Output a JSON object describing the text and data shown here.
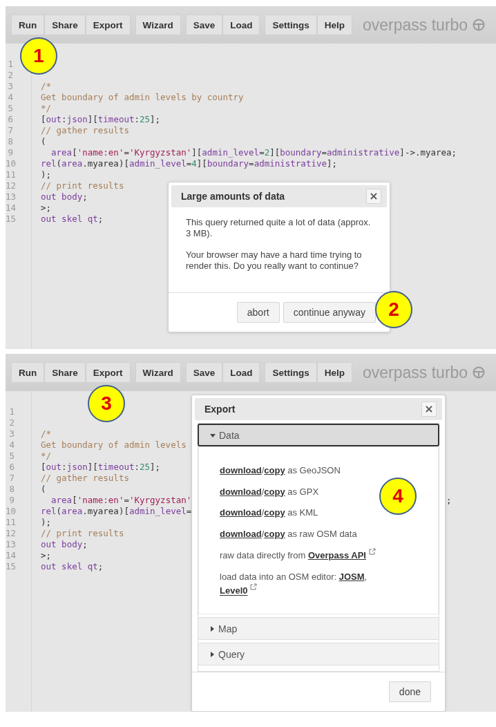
{
  "panels": [
    {
      "toolbar": {
        "groups": [
          [
            "Run",
            "Share",
            "Export"
          ],
          [
            "Wizard"
          ],
          [
            "Save",
            "Load"
          ],
          [
            "Settings",
            "Help"
          ]
        ],
        "brand": "overpass turbo"
      },
      "code": [
        {
          "number": "1"
        },
        {
          "number": "2"
        },
        {
          "number": "3",
          "tokens": [
            {
              "kind": "comment",
              "t": "/*"
            }
          ]
        },
        {
          "number": "4",
          "tokens": [
            {
              "kind": "comment",
              "t": "Get boundary of admin levels by country"
            }
          ]
        },
        {
          "number": "5",
          "tokens": [
            {
              "kind": "comment",
              "t": "*/"
            }
          ]
        },
        {
          "number": "6",
          "tokens": [
            {
              "kind": "punct",
              "t": "["
            },
            {
              "kind": "keyword",
              "t": "out"
            },
            {
              "kind": "punct",
              "t": ":"
            },
            {
              "kind": "keyword",
              "t": "json"
            },
            {
              "kind": "punct",
              "t": "]["
            },
            {
              "kind": "keyword",
              "t": "timeout"
            },
            {
              "kind": "punct",
              "t": ":"
            },
            {
              "kind": "number",
              "t": "25"
            },
            {
              "kind": "punct",
              "t": "];"
            }
          ]
        },
        {
          "number": "7",
          "tokens": [
            {
              "kind": "comment",
              "t": "// gather results"
            }
          ]
        },
        {
          "number": "8",
          "tokens": [
            {
              "kind": "punct",
              "t": "("
            }
          ]
        },
        {
          "number": "9",
          "indented": true,
          "tokens": [
            {
              "kind": "keyword",
              "t": "area"
            },
            {
              "kind": "punct",
              "t": "["
            },
            {
              "kind": "string",
              "t": "'name:en'"
            },
            {
              "kind": "punct",
              "t": "="
            },
            {
              "kind": "string",
              "t": "'Kyrgyzstan'"
            },
            {
              "kind": "punct",
              "t": "]["
            },
            {
              "kind": "keyword",
              "t": "admin_level"
            },
            {
              "kind": "punct",
              "t": "="
            },
            {
              "kind": "number",
              "t": "2"
            },
            {
              "kind": "punct",
              "t": "]["
            },
            {
              "kind": "keyword",
              "t": "boundary"
            },
            {
              "kind": "punct",
              "t": "="
            },
            {
              "kind": "keyword",
              "t": "administrative"
            },
            {
              "kind": "punct",
              "t": "]->.myarea;"
            }
          ]
        },
        {
          "number": "10",
          "tokens": [
            {
              "kind": "keyword",
              "t": "rel"
            },
            {
              "kind": "punct",
              "t": "("
            },
            {
              "kind": "keyword",
              "t": "area"
            },
            {
              "kind": "punct",
              "t": ".myarea)["
            },
            {
              "kind": "keyword",
              "t": "admin_level"
            },
            {
              "kind": "punct",
              "t": "="
            },
            {
              "kind": "number",
              "t": "4"
            },
            {
              "kind": "punct",
              "t": "]["
            },
            {
              "kind": "keyword",
              "t": "boundary"
            },
            {
              "kind": "punct",
              "t": "="
            },
            {
              "kind": "keyword",
              "t": "administrative"
            },
            {
              "kind": "punct",
              "t": "];"
            }
          ]
        },
        {
          "number": "11",
          "tokens": [
            {
              "kind": "punct",
              "t": ");"
            }
          ]
        },
        {
          "number": "12",
          "tokens": [
            {
              "kind": "comment",
              "t": "// print results"
            }
          ]
        },
        {
          "number": "13",
          "tokens": [
            {
              "kind": "keyword",
              "t": "out body"
            },
            {
              "kind": "punct",
              "t": ";"
            }
          ]
        },
        {
          "number": "14",
          "tokens": [
            {
              "kind": "punct",
              "t": ">;"
            }
          ]
        },
        {
          "number": "15",
          "tokens": [
            {
              "kind": "keyword",
              "t": "out skel qt"
            },
            {
              "kind": "punct",
              "t": ";"
            }
          ]
        }
      ],
      "dialog": {
        "kind": "confirm",
        "title": "Large amounts of data",
        "close": "×",
        "paragraphs": [
          "This query returned quite a lot of data (approx. 3 MB).",
          "Your browser may have a hard time trying to render this. Do you really want to continue?"
        ],
        "buttons": [
          "abort",
          "continue anyway"
        ]
      },
      "markers": [
        "1",
        "2"
      ]
    },
    {
      "toolbar": {
        "groups": [
          [
            "Run",
            "Share",
            "Export"
          ],
          [
            "Wizard"
          ],
          [
            "Save",
            "Load"
          ],
          [
            "Settings",
            "Help"
          ]
        ],
        "brand": "overpass turbo"
      },
      "code": [
        {
          "number": "1"
        },
        {
          "number": "2"
        },
        {
          "number": "3",
          "tokens": [
            {
              "kind": "comment",
              "t": "/*"
            }
          ]
        },
        {
          "number": "4",
          "tokens": [
            {
              "kind": "comment",
              "t": "Get boundary of admin levels"
            }
          ]
        },
        {
          "number": "5",
          "tokens": [
            {
              "kind": "comment",
              "t": "*/"
            }
          ]
        },
        {
          "number": "6",
          "tokens": [
            {
              "kind": "punct",
              "t": "["
            },
            {
              "kind": "keyword",
              "t": "out"
            },
            {
              "kind": "punct",
              "t": ":"
            },
            {
              "kind": "keyword",
              "t": "json"
            },
            {
              "kind": "punct",
              "t": "]["
            },
            {
              "kind": "keyword",
              "t": "timeout"
            },
            {
              "kind": "punct",
              "t": ":"
            },
            {
              "kind": "number",
              "t": "25"
            },
            {
              "kind": "punct",
              "t": "];"
            }
          ]
        },
        {
          "number": "7",
          "tokens": [
            {
              "kind": "comment",
              "t": "// gather results"
            }
          ]
        },
        {
          "number": "8",
          "tokens": [
            {
              "kind": "punct",
              "t": "("
            }
          ]
        },
        {
          "number": "9",
          "indented": true,
          "tokens": [
            {
              "kind": "keyword",
              "t": "area"
            },
            {
              "kind": "punct",
              "t": "["
            },
            {
              "kind": "string",
              "t": "'name:en'"
            },
            {
              "kind": "punct",
              "t": "="
            },
            {
              "kind": "string",
              "t": "'Kyrgyzstan'"
            }
          ],
          "tail": ";"
        },
        {
          "number": "10",
          "tokens": [
            {
              "kind": "keyword",
              "t": "rel"
            },
            {
              "kind": "punct",
              "t": "("
            },
            {
              "kind": "keyword",
              "t": "area"
            },
            {
              "kind": "punct",
              "t": ".myarea)["
            },
            {
              "kind": "keyword",
              "t": "admin_level"
            },
            {
              "kind": "punct",
              "t": "="
            }
          ]
        },
        {
          "number": "11",
          "tokens": [
            {
              "kind": "punct",
              "t": ");"
            }
          ]
        },
        {
          "number": "12",
          "tokens": [
            {
              "kind": "comment",
              "t": "// print results"
            }
          ]
        },
        {
          "number": "13",
          "tokens": [
            {
              "kind": "keyword",
              "t": "out body"
            },
            {
              "kind": "punct",
              "t": ";"
            }
          ]
        },
        {
          "number": "14",
          "tokens": [
            {
              "kind": "punct",
              "t": ">;"
            }
          ]
        },
        {
          "number": "15",
          "tokens": [
            {
              "kind": "keyword",
              "t": "out skel qt"
            },
            {
              "kind": "punct",
              "t": ";"
            }
          ]
        }
      ],
      "dialog": {
        "kind": "export",
        "title": "Export",
        "close": "×",
        "sections": [
          {
            "title": "Data",
            "expanded": true,
            "items": [
              [
                {
                  "kind": "link",
                  "t": "download"
                },
                {
                  "kind": "text",
                  "t": "/"
                },
                {
                  "kind": "link",
                  "t": "copy"
                },
                {
                  "kind": "text",
                  "t": " as GeoJSON"
                }
              ],
              [
                {
                  "kind": "link",
                  "t": "download"
                },
                {
                  "kind": "text",
                  "t": "/"
                },
                {
                  "kind": "link",
                  "t": "copy"
                },
                {
                  "kind": "text",
                  "t": " as GPX"
                }
              ],
              [
                {
                  "kind": "link",
                  "t": "download"
                },
                {
                  "kind": "text",
                  "t": "/"
                },
                {
                  "kind": "link",
                  "t": "copy"
                },
                {
                  "kind": "text",
                  "t": " as KML"
                }
              ],
              [
                {
                  "kind": "link",
                  "t": "download"
                },
                {
                  "kind": "text",
                  "t": "/"
                },
                {
                  "kind": "link",
                  "t": "copy"
                },
                {
                  "kind": "text",
                  "t": " as raw OSM data"
                }
              ],
              [
                {
                  "kind": "text",
                  "t": "raw data directly from "
                },
                {
                  "kind": "external",
                  "t": "Overpass API"
                }
              ],
              [
                {
                  "kind": "text",
                  "t": "load data into an OSM editor: "
                },
                {
                  "kind": "link",
                  "t": "JOSM"
                },
                {
                  "kind": "text",
                  "t": ", "
                },
                {
                  "kind": "external",
                  "t": "Level0"
                }
              ]
            ]
          },
          {
            "title": "Map",
            "expanded": false
          },
          {
            "title": "Query",
            "expanded": false
          }
        ],
        "buttons": [
          "done"
        ]
      },
      "markers": [
        "3",
        "4"
      ]
    }
  ]
}
